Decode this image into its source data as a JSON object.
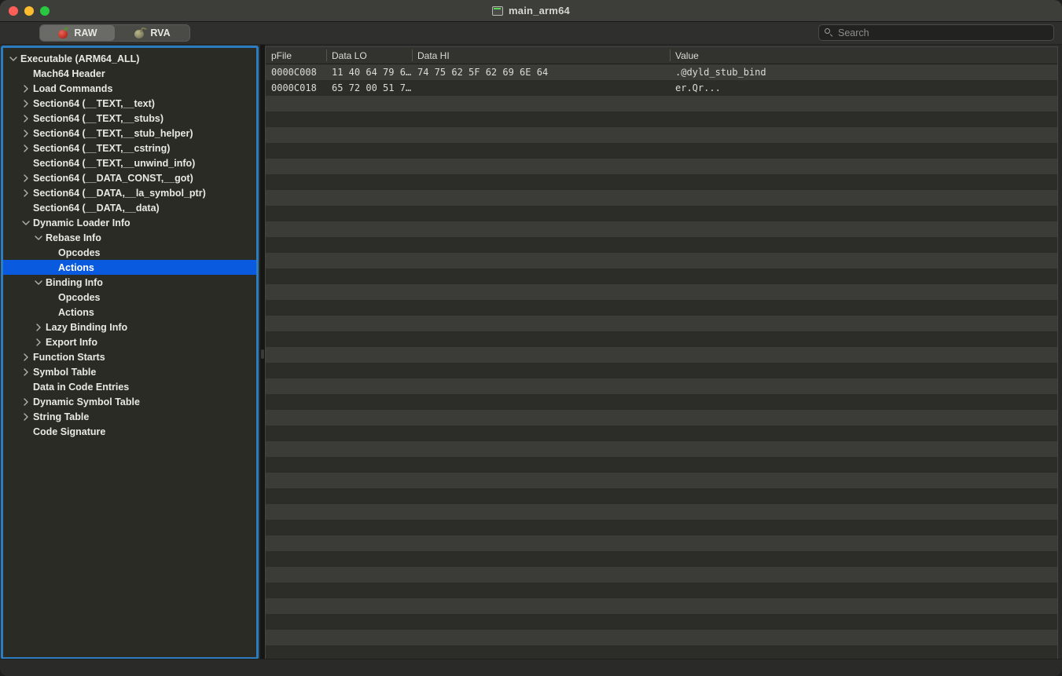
{
  "window": {
    "title": "main_arm64",
    "title_icon": "window-terminal-icon",
    "traffic_lights": [
      {
        "name": "close",
        "color": "#ff5f57"
      },
      {
        "name": "minimize",
        "color": "#febc2e"
      },
      {
        "name": "zoom",
        "color": "#28c840"
      }
    ]
  },
  "toolbar": {
    "segments": [
      {
        "label": "RAW",
        "icon": "apple-icon",
        "selected": true
      },
      {
        "label": "RVA",
        "icon": "bomb-icon",
        "selected": false
      }
    ],
    "search": {
      "placeholder": "Search",
      "value": "",
      "icon": "search-icon"
    }
  },
  "sidebar": {
    "selected_index": 14,
    "items": [
      {
        "label": "Executable  (ARM64_ALL)",
        "indent": 0,
        "twisty": "down"
      },
      {
        "label": "Mach64 Header",
        "indent": 1,
        "twisty": "none"
      },
      {
        "label": "Load Commands",
        "indent": 1,
        "twisty": "right"
      },
      {
        "label": "Section64 (__TEXT,__text)",
        "indent": 1,
        "twisty": "right"
      },
      {
        "label": "Section64 (__TEXT,__stubs)",
        "indent": 1,
        "twisty": "right"
      },
      {
        "label": "Section64 (__TEXT,__stub_helper)",
        "indent": 1,
        "twisty": "right"
      },
      {
        "label": "Section64 (__TEXT,__cstring)",
        "indent": 1,
        "twisty": "right"
      },
      {
        "label": "Section64 (__TEXT,__unwind_info)",
        "indent": 1,
        "twisty": "none"
      },
      {
        "label": "Section64 (__DATA_CONST,__got)",
        "indent": 1,
        "twisty": "right"
      },
      {
        "label": "Section64 (__DATA,__la_symbol_ptr)",
        "indent": 1,
        "twisty": "right"
      },
      {
        "label": "Section64 (__DATA,__data)",
        "indent": 1,
        "twisty": "none"
      },
      {
        "label": "Dynamic Loader Info",
        "indent": 1,
        "twisty": "down"
      },
      {
        "label": "Rebase Info",
        "indent": 2,
        "twisty": "down"
      },
      {
        "label": "Opcodes",
        "indent": 3,
        "twisty": "none"
      },
      {
        "label": "Actions",
        "indent": 3,
        "twisty": "none"
      },
      {
        "label": "Binding Info",
        "indent": 2,
        "twisty": "down"
      },
      {
        "label": "Opcodes",
        "indent": 3,
        "twisty": "none"
      },
      {
        "label": "Actions",
        "indent": 3,
        "twisty": "none"
      },
      {
        "label": "Lazy Binding Info",
        "indent": 2,
        "twisty": "right"
      },
      {
        "label": "Export Info",
        "indent": 2,
        "twisty": "right"
      },
      {
        "label": "Function Starts",
        "indent": 1,
        "twisty": "right"
      },
      {
        "label": "Symbol Table",
        "indent": 1,
        "twisty": "right"
      },
      {
        "label": "Data in Code Entries",
        "indent": 1,
        "twisty": "none"
      },
      {
        "label": "Dynamic Symbol Table",
        "indent": 1,
        "twisty": "right"
      },
      {
        "label": "String Table",
        "indent": 1,
        "twisty": "right"
      },
      {
        "label": "Code Signature",
        "indent": 1,
        "twisty": "none"
      }
    ]
  },
  "table": {
    "columns": [
      {
        "key": "pfile",
        "label": "pFile"
      },
      {
        "key": "lo",
        "label": "Data LO"
      },
      {
        "key": "hi",
        "label": "Data HI"
      },
      {
        "key": "value",
        "label": "Value"
      }
    ],
    "rows": [
      {
        "pfile": "0000C008",
        "lo": "11 40 64 79 6…",
        "hi": "74 75 62 5F 62 69 6E 64",
        "value": ".@dyld_stub_bind"
      },
      {
        "pfile": "0000C018",
        "lo": "65 72 00 51 7…",
        "hi": "",
        "value": "er.Qr..."
      }
    ],
    "empty_row_count": 37
  },
  "colors": {
    "focus_ring": "#2b7cc0",
    "selection": "#0a5ae0",
    "window_bg": "#2a2a28",
    "sidebar_bg": "#2b2b26",
    "row_odd": "#3b3b37",
    "row_even": "#2c2c29"
  }
}
